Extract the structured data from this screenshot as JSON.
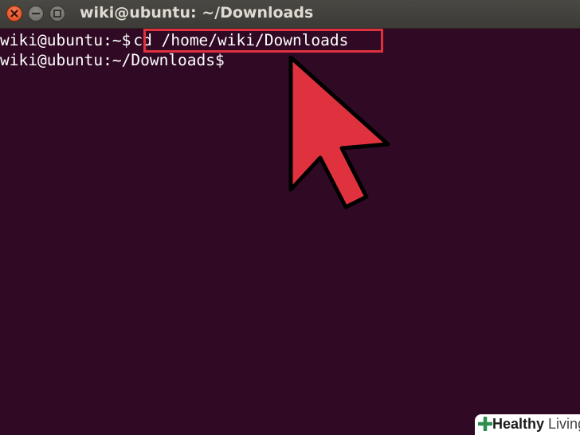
{
  "window": {
    "title": "wiki@ubuntu: ~/Downloads",
    "buttons": [
      {
        "name": "close",
        "icon": "close-icon",
        "color": "#df4b16"
      },
      {
        "name": "minimize",
        "icon": "minimize-icon",
        "color": "#6a6964"
      },
      {
        "name": "maximize",
        "icon": "maximize-icon",
        "color": "#6a6964"
      }
    ]
  },
  "terminal": {
    "background": "#300a24",
    "lines": [
      {
        "prompt": "wiki@ubuntu:~$",
        "command": "cd /home/wiki/Downloads"
      },
      {
        "prompt": "wiki@ubuntu:~/Downloads$",
        "command": ""
      }
    ]
  },
  "annotation": {
    "highlight_color": "#e0323e",
    "icon": "pointer-arrow-icon"
  },
  "watermark": {
    "icon": "plus-cross-icon",
    "text_bold": "Healthy",
    "text_light": "Living"
  }
}
